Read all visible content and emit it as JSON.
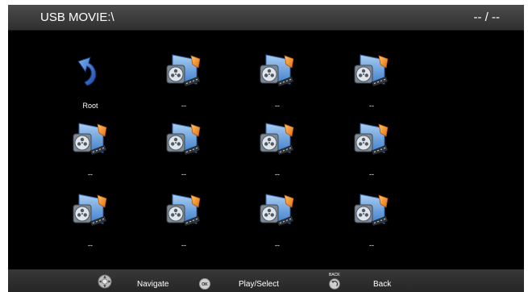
{
  "header": {
    "path": "USB MOVIE:\\",
    "page_counter": "-- / --"
  },
  "grid": {
    "items": [
      {
        "label": "Root",
        "icon": "back-arrow-icon"
      },
      {
        "label": "--",
        "icon": "movie-file-icon"
      },
      {
        "label": "--",
        "icon": "movie-file-icon"
      },
      {
        "label": "--",
        "icon": "movie-file-icon"
      },
      {
        "label": "--",
        "icon": "movie-file-icon"
      },
      {
        "label": "--",
        "icon": "movie-file-icon"
      },
      {
        "label": "--",
        "icon": "movie-file-icon"
      },
      {
        "label": "--",
        "icon": "movie-file-icon"
      },
      {
        "label": "--",
        "icon": "movie-file-icon"
      },
      {
        "label": "--",
        "icon": "movie-file-icon"
      },
      {
        "label": "--",
        "icon": "movie-file-icon"
      },
      {
        "label": "--",
        "icon": "movie-file-icon"
      }
    ]
  },
  "footer": {
    "navigate_label": "Navigate",
    "ok_glyph": "OK",
    "play_label": "Play/Select",
    "back_caption": "BACK",
    "back_label": "Back"
  },
  "colors": {
    "background": "#000000",
    "header_bar": "#3d3d3d",
    "text": "#ffffff",
    "arrow_blue": "#1e6ad0",
    "film_blue": "#4f8fd6",
    "clapper_orange": "#f28c1c"
  }
}
